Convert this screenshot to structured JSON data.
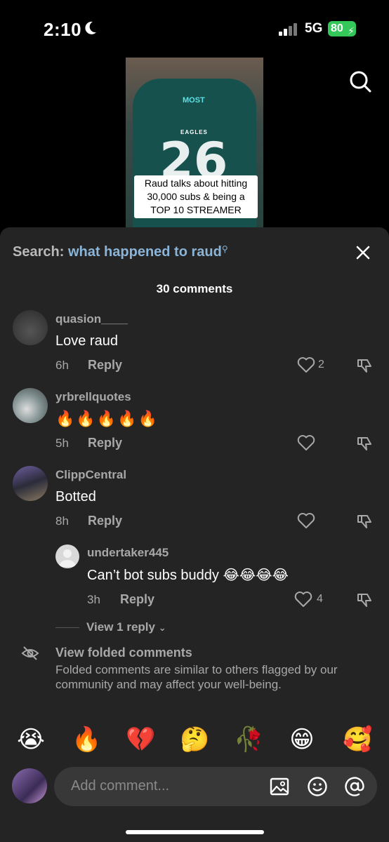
{
  "status": {
    "time": "2:10",
    "network": "5G",
    "battery": "80"
  },
  "video": {
    "overlay_tag": "MOST",
    "jersey_team": "EAGLES",
    "jersey_number": "26",
    "caption": "Raud talks about hitting 30,000 subs & being a TOP 10 STREAMER"
  },
  "search": {
    "label": "Search:",
    "term": "what happened to raud"
  },
  "comments_header": "30 comments",
  "comments": [
    {
      "username": "quasion____",
      "text": "Love raud",
      "time": "6h",
      "reply_label": "Reply",
      "likes": "2"
    },
    {
      "username": "yrbrellquotes",
      "text": "🔥🔥🔥🔥🔥",
      "time": "5h",
      "reply_label": "Reply",
      "likes": ""
    },
    {
      "username": "ClippCentral",
      "text": "Botted",
      "time": "8h",
      "reply_label": "Reply",
      "likes": ""
    }
  ],
  "reply": {
    "username": "undertaker445",
    "text": "Can’t bot subs buddy 😂😂😂😂",
    "time": "3h",
    "reply_label": "Reply",
    "likes": "4"
  },
  "view_replies": "View 1 reply",
  "folded": {
    "title": "View folded comments",
    "description": "Folded comments are similar to others flagged by our community and may affect your well-being."
  },
  "quick_emojis": [
    "😭",
    "🔥",
    "💔",
    "🤔",
    "🥀",
    "😁",
    "🥰"
  ],
  "input": {
    "placeholder": "Add comment..."
  },
  "colors": {
    "sheet_bg": "#242424",
    "search_term": "#8ab4d8",
    "muted": "#a8a8a8",
    "battery": "#34c759"
  }
}
